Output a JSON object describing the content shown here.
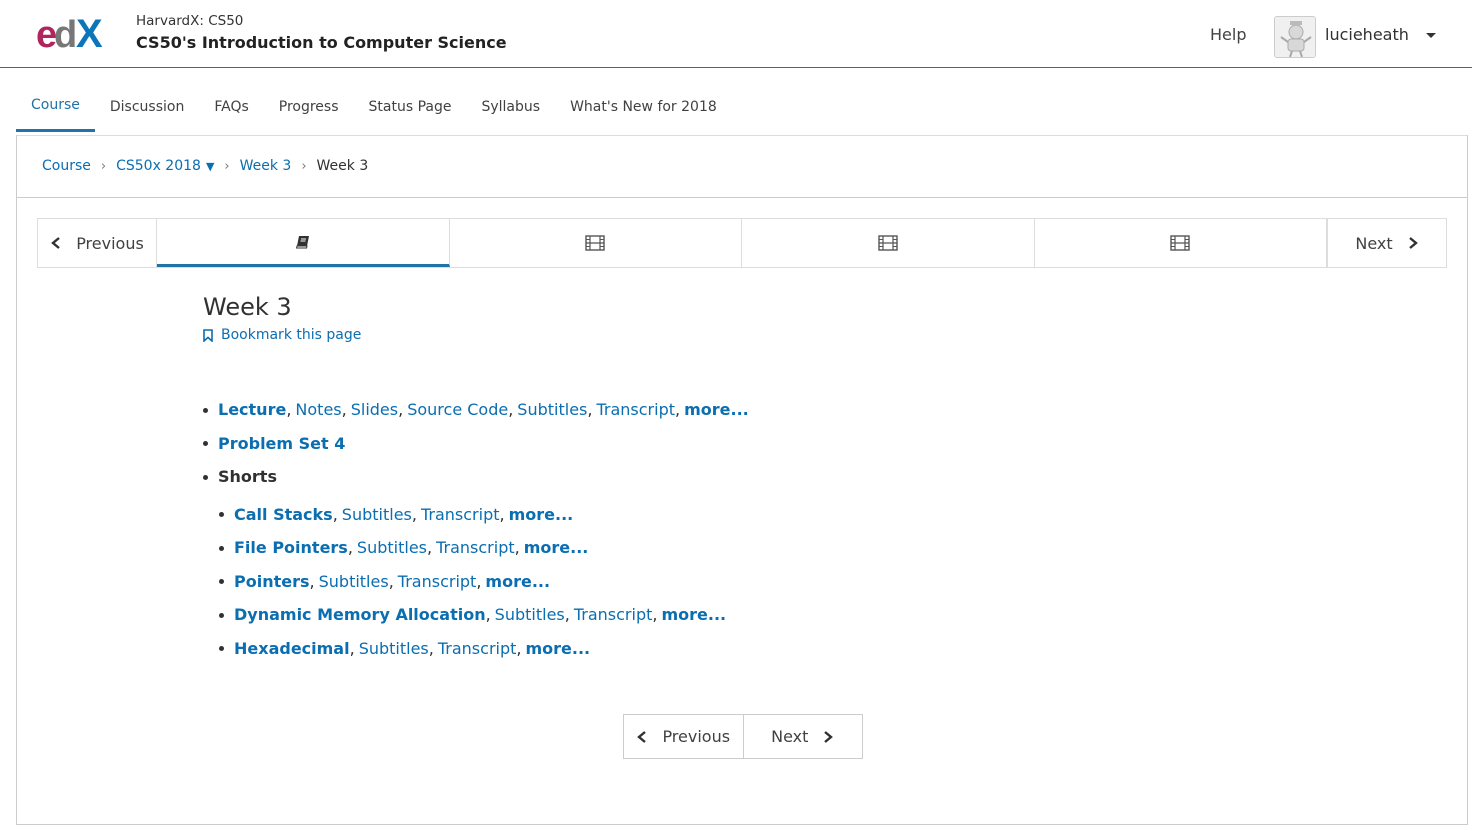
{
  "header": {
    "logo_text": "edX",
    "course_org": "HarvardX: CS50",
    "course_title": "CS50's Introduction to Computer Science",
    "help": "Help",
    "username": "lucieheath"
  },
  "tabs": [
    {
      "label": "Course",
      "active": true
    },
    {
      "label": "Discussion"
    },
    {
      "label": "FAQs"
    },
    {
      "label": "Progress"
    },
    {
      "label": "Status Page"
    },
    {
      "label": "Syllabus"
    },
    {
      "label": "What's New for 2018"
    }
  ],
  "breadcrumb": {
    "course": "Course",
    "section": "CS50x 2018",
    "subsection": "Week 3",
    "current": "Week 3"
  },
  "sequence": {
    "previous": "Previous",
    "next": "Next",
    "items": [
      {
        "icon": "book-icon",
        "active": true
      },
      {
        "icon": "video-icon"
      },
      {
        "icon": "video-icon"
      },
      {
        "icon": "video-icon"
      }
    ]
  },
  "unit": {
    "title": "Week 3",
    "bookmark": "Bookmark this page"
  },
  "content": {
    "lecture": {
      "main": "Lecture",
      "links": [
        "Notes",
        "Slides",
        "Source Code",
        "Subtitles",
        "Transcript"
      ],
      "more": "more..."
    },
    "problem_set": "Problem Set 4",
    "shorts_label": "Shorts",
    "shorts": [
      {
        "title": "Call Stacks",
        "links": [
          "Subtitles",
          "Transcript"
        ],
        "more": "more..."
      },
      {
        "title": "File Pointers",
        "links": [
          "Subtitles",
          "Transcript"
        ],
        "more": "more..."
      },
      {
        "title": "Pointers",
        "links": [
          "Subtitles",
          "Transcript"
        ],
        "more": "more..."
      },
      {
        "title": "Dynamic Memory Allocation",
        "links": [
          "Subtitles",
          "Transcript"
        ],
        "more": "more..."
      },
      {
        "title": "Hexadecimal",
        "links": [
          "Subtitles",
          "Transcript"
        ],
        "more": "more..."
      }
    ]
  },
  "bottom_nav": {
    "previous": "Previous",
    "next": "Next"
  },
  "colors": {
    "accent": "#1e73a8",
    "link": "#0a6eb1",
    "logo_e": "#b0255e",
    "logo_d": "#777777",
    "logo_x": "#0c75ba"
  }
}
